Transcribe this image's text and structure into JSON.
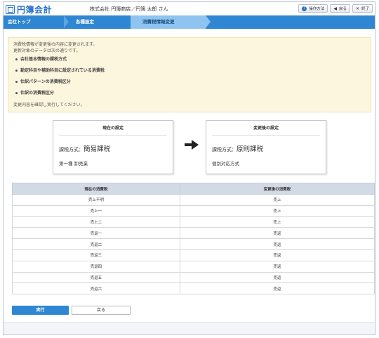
{
  "app": {
    "logo_text": "円簿会計",
    "user_info": "株式会社 円簿商店／円簿 太郎 さん"
  },
  "top_buttons": {
    "help": "操作方法",
    "back": "戻る",
    "close": "終了"
  },
  "breadcrumb": {
    "items": [
      "会社トップ",
      "各種設定",
      "消費税情報変更"
    ]
  },
  "notice": {
    "line1": "消費税情報が変更後の内容に変更されます。",
    "line2": "更新対象のデータは次の通りです。",
    "items": [
      "会社基本情報の課税方式",
      "勘定科目や補助科目に設定されている消費税",
      "仕訳パターンの消費税区分",
      "仕訳の消費税区分"
    ],
    "confirm": "変更内容を確認し実行してください。"
  },
  "current_setting": {
    "title": "現在の設定",
    "method_label": "課税方式：",
    "method_value": "簡易課税",
    "sub": "第一種 卸売業"
  },
  "new_setting": {
    "title": "変更後の設定",
    "method_label": "課税方式：",
    "method_value": "原則課税",
    "sub": "個別対応方式"
  },
  "table": {
    "headers": [
      "現在の消費税",
      "変更後の消費税"
    ],
    "rows": [
      [
        "売上不明",
        "売上"
      ],
      [
        "売上一",
        "売上"
      ],
      [
        "売上二",
        "売上"
      ],
      [
        "売返一",
        "売返"
      ],
      [
        "売返二",
        "売返"
      ],
      [
        "売返三",
        "売返"
      ],
      [
        "売返四",
        "売返"
      ],
      [
        "売返五",
        "売返"
      ],
      [
        "売返六",
        "売返"
      ]
    ]
  },
  "actions": {
    "execute": "実行",
    "back": "戻る"
  },
  "colors": {
    "accent": "#2f86d2",
    "notice_bg": "#fdf6de",
    "table_header": "#d2dae6"
  }
}
